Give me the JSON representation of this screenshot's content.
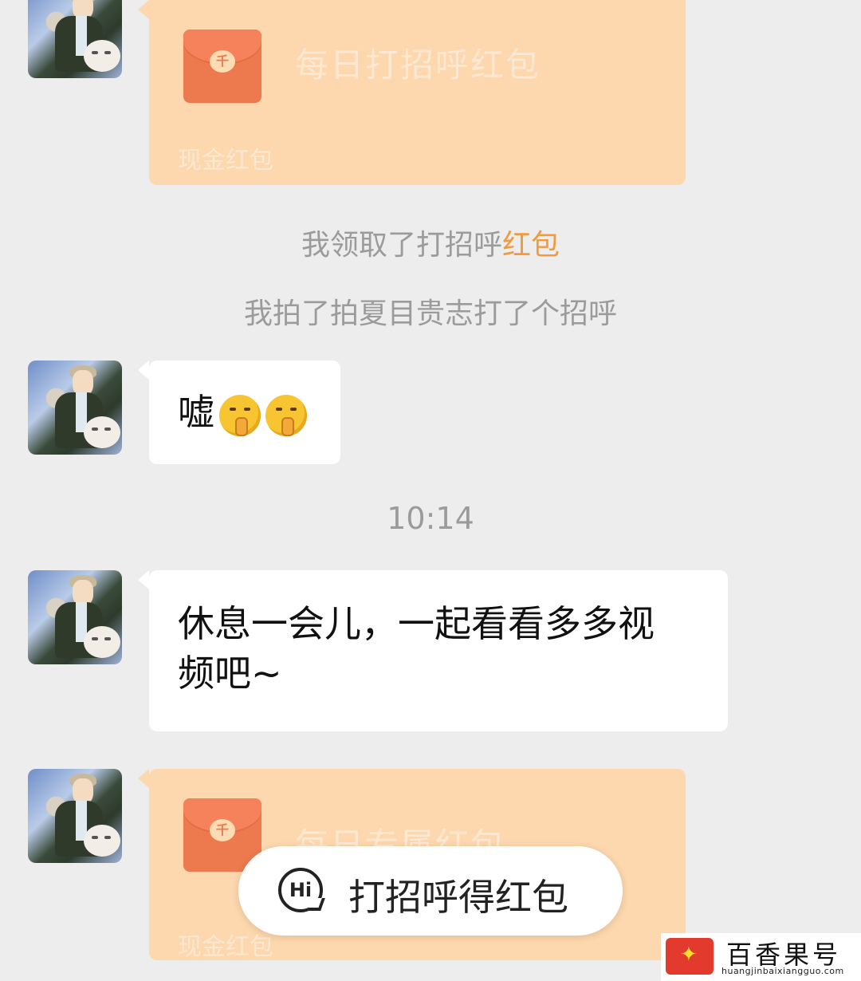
{
  "messages": {
    "redpacket_1": {
      "title": "每日打招呼红包",
      "subtitle": "现金红包",
      "coin": "千"
    },
    "system_1": {
      "prefix": "我领取了打招呼",
      "highlight": "红包"
    },
    "system_2": {
      "text": "我拍了拍夏目贵志打了个招呼"
    },
    "msg_1": {
      "text": "嘘"
    },
    "timestamp": "10:14",
    "msg_2": {
      "line1": "休息一会儿，一起看看多多视",
      "line2": "频吧~"
    },
    "redpacket_2": {
      "title": "每日专属红包",
      "subtitle": "现金红包",
      "coin": "千"
    }
  },
  "cta": {
    "icon_text": "Hi",
    "label": "打招呼得红包"
  },
  "watermark": {
    "name": "百香果号",
    "url": "huangjinbaixiangguo.com"
  },
  "colors": {
    "background": "#ededed",
    "redpacket": "#fdd7ad",
    "highlight": "#f19a3e",
    "envelope": "#ec7a4e"
  },
  "icons": [
    "avatar",
    "red-envelope-icon",
    "shush-emoji",
    "hi-chat-icon",
    "logo-icon"
  ]
}
